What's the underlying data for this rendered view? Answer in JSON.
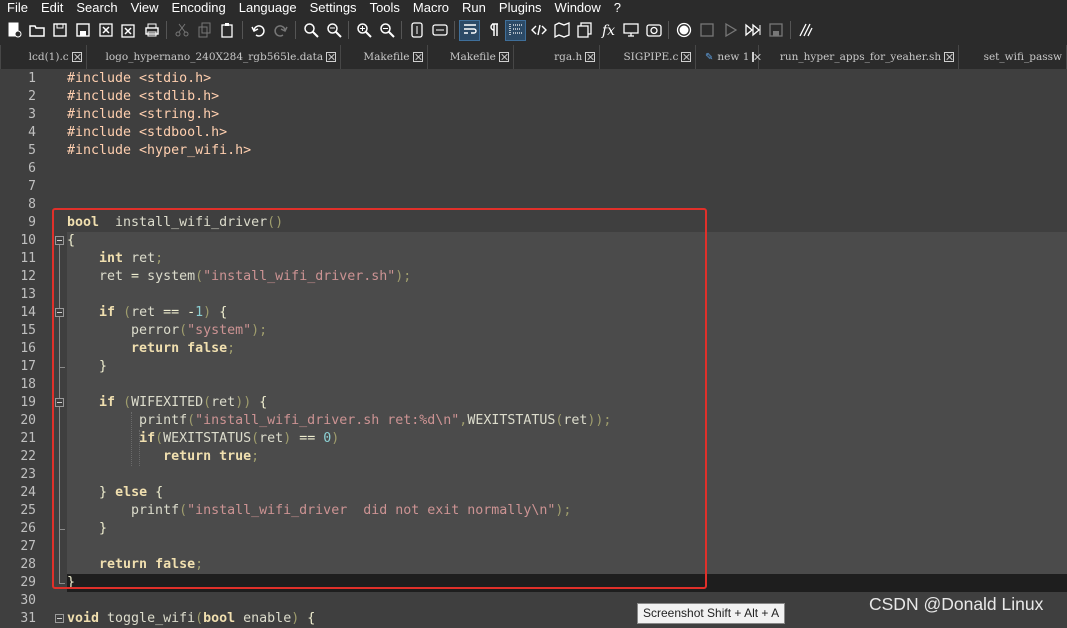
{
  "menu": [
    "File",
    "Edit",
    "Search",
    "View",
    "Encoding",
    "Language",
    "Settings",
    "Tools",
    "Macro",
    "Run",
    "Plugins",
    "Window",
    "?"
  ],
  "toolbar_icons": [
    "new-file-icon",
    "open-file-icon",
    "save-icon",
    "save-all-icon",
    "close-icon",
    "close-all-icon",
    "print-icon",
    "cut-icon",
    "copy-icon",
    "paste-icon",
    "undo-icon",
    "redo-icon",
    "find-icon",
    "replace-icon",
    "zoom-in-icon",
    "zoom-out-icon",
    "sync-vertical-icon",
    "sync-horizontal-icon",
    "word-wrap-icon",
    "show-all-characters-icon",
    "indent-guide-icon",
    "language-xml-icon",
    "document-map-icon",
    "document-list-icon",
    "function-list-icon",
    "monitor-icon",
    "screenshot-icon",
    "record-macro-icon",
    "stop-macro-icon",
    "play-macro-icon",
    "run-macro-multiple-icon",
    "save-macro-icon",
    "spell-check-icon"
  ],
  "tabs": [
    {
      "label": "lcd(1).c"
    },
    {
      "label": "logo_hypernano_240X284_rgb565le.data"
    },
    {
      "label": "Makefile"
    },
    {
      "label": "Makefile"
    },
    {
      "label": "rga.h"
    },
    {
      "label": "SIGPIPE.c"
    },
    {
      "label": "new 1"
    },
    {
      "label": "run_hyper_apps_for_yeaher.sh"
    },
    {
      "label": "set_wifi_passw"
    }
  ],
  "line_numbers": [
    "1",
    "2",
    "3",
    "4",
    "5",
    "6",
    "7",
    "8",
    "9",
    "10",
    "11",
    "12",
    "13",
    "14",
    "15",
    "16",
    "17",
    "18",
    "19",
    "20",
    "21",
    "22",
    "23",
    "24",
    "25",
    "26",
    "27",
    "28",
    "29",
    "30",
    "31"
  ],
  "code_lines": [
    [
      [
        "pp",
        "#include <stdio.h>"
      ]
    ],
    [
      [
        "pp",
        "#include <stdlib.h>"
      ]
    ],
    [
      [
        "pp",
        "#include <string.h>"
      ]
    ],
    [
      [
        "pp",
        "#include <stdbool.h>"
      ]
    ],
    [
      [
        "pp",
        "#include <hyper_wifi.h>"
      ]
    ],
    [],
    [],
    [],
    [
      [
        "kw",
        "bool"
      ],
      [
        "",
        "  install_wifi_driver"
      ],
      [
        "pn",
        "()"
      ]
    ],
    [
      [
        "op",
        "{"
      ]
    ],
    [
      [
        "",
        "    "
      ],
      [
        "kw",
        "int"
      ],
      [
        "",
        " ret"
      ],
      [
        "pn",
        ";"
      ]
    ],
    [
      [
        "",
        "    ret "
      ],
      [
        "op",
        "="
      ],
      [
        "",
        " system"
      ],
      [
        "pn",
        "("
      ],
      [
        "str",
        "\"install_wifi_driver.sh\""
      ],
      [
        "pn",
        ");"
      ]
    ],
    [],
    [
      [
        "",
        "    "
      ],
      [
        "kw",
        "if"
      ],
      [
        "",
        "",
        " "
      ],
      [
        "pn",
        "("
      ],
      [
        "",
        "ret "
      ],
      [
        "op",
        "=="
      ],
      [
        "",
        "",
        " "
      ],
      [
        "op",
        "-"
      ],
      [
        "num",
        "1"
      ],
      [
        "pn",
        ")"
      ],
      [
        "",
        " "
      ],
      [
        "op",
        "{"
      ]
    ],
    [
      [
        "",
        "        perror"
      ],
      [
        "pn",
        "("
      ],
      [
        "str",
        "\"system\""
      ],
      [
        "pn",
        ");"
      ]
    ],
    [
      [
        "",
        "        "
      ],
      [
        "kw",
        "return"
      ],
      [
        "",
        " "
      ],
      [
        "kw",
        "false"
      ],
      [
        "pn",
        ";"
      ]
    ],
    [
      [
        "",
        "    "
      ],
      [
        "op",
        "}"
      ]
    ],
    [],
    [
      [
        "",
        "    "
      ],
      [
        "kw",
        "if"
      ],
      [
        "",
        " "
      ],
      [
        "pn",
        "("
      ],
      [
        "",
        "WIFEXITED"
      ],
      [
        "pn",
        "("
      ],
      [
        "",
        "ret"
      ],
      [
        "pn",
        "))"
      ],
      [
        "",
        " "
      ],
      [
        "op",
        "{"
      ]
    ],
    [
      [
        "",
        "         printf"
      ],
      [
        "pn",
        "("
      ],
      [
        "str",
        "\"install_wifi_driver.sh ret:%d\\n\""
      ],
      [
        "pn",
        ","
      ],
      [
        "",
        "WEXITSTATUS"
      ],
      [
        "pn",
        "("
      ],
      [
        "",
        "ret"
      ],
      [
        "pn",
        "));"
      ]
    ],
    [
      [
        "",
        "         "
      ],
      [
        "kw",
        "if"
      ],
      [
        "pn",
        "("
      ],
      [
        "",
        "WEXITSTATUS"
      ],
      [
        "pn",
        "("
      ],
      [
        "",
        "ret"
      ],
      [
        "pn",
        ")"
      ],
      [
        "",
        " "
      ],
      [
        "op",
        "=="
      ],
      [
        "",
        " "
      ],
      [
        "num",
        "0"
      ],
      [
        "pn",
        ")"
      ]
    ],
    [
      [
        "",
        "            "
      ],
      [
        "kw",
        "return"
      ],
      [
        "",
        " "
      ],
      [
        "kw",
        "true"
      ],
      [
        "pn",
        ";"
      ]
    ],
    [],
    [
      [
        "",
        "    "
      ],
      [
        "op",
        "}"
      ],
      [
        "",
        " "
      ],
      [
        "kw",
        "else"
      ],
      [
        "",
        " "
      ],
      [
        "op",
        "{"
      ]
    ],
    [
      [
        "",
        "        printf"
      ],
      [
        "pn",
        "("
      ],
      [
        "str",
        "\"install_wifi_driver  did not exit normally\\n\""
      ],
      [
        "pn",
        ");"
      ]
    ],
    [
      [
        "",
        "    "
      ],
      [
        "op",
        "}"
      ]
    ],
    [],
    [
      [
        "",
        "    "
      ],
      [
        "kw",
        "return"
      ],
      [
        "",
        " "
      ],
      [
        "kw",
        "false"
      ],
      [
        "pn",
        ";"
      ]
    ],
    [
      [
        "op",
        "}"
      ]
    ],
    [],
    [
      [
        "kw",
        "void"
      ],
      [
        "",
        " toggle_wifi"
      ],
      [
        "pn",
        "("
      ],
      [
        "kw",
        "bool"
      ],
      [
        "",
        " enable"
      ],
      [
        "pn",
        ")"
      ],
      [
        "",
        " "
      ],
      [
        "op",
        "{"
      ]
    ]
  ],
  "tooltip": "Screenshot Shift + Alt + A",
  "watermark": "CSDN @Donald Linux",
  "colors": {
    "highlight_box": "#e0302a",
    "background": "#3f3f3f",
    "keyword": "#f0dfaf",
    "string": "#cc9393",
    "number": "#8cd0d3"
  }
}
